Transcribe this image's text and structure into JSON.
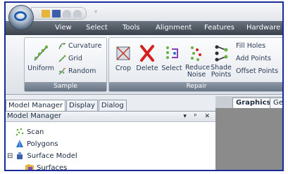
{
  "quick_access": {
    "icons": [
      "open-icon",
      "save-icon",
      "undo-icon",
      "redo-icon"
    ],
    "menu_glyph": "▿"
  },
  "menu_tabs": [
    "View",
    "Select",
    "Tools",
    "Alignment",
    "Features",
    "Hardware"
  ],
  "ribbon": {
    "sample_group": {
      "label": "Sample",
      "uniform": "Uniform",
      "curvature": "Curvature",
      "grid": "Grid",
      "random": "Random"
    },
    "repair_group": {
      "label": "Repair",
      "crop": "Crop",
      "delete": "Delete",
      "select": "Select",
      "reduce_noise_line1": "Reduce",
      "reduce_noise_line2": "Noise",
      "shade_points_line1": "Shade",
      "shade_points_line2": "Points",
      "fill_holes": "Fill Holes",
      "add_points": "Add Points",
      "offset_points": "Offset Points"
    }
  },
  "panel_tabs": [
    "Model Manager",
    "Display",
    "Dialog"
  ],
  "model_manager": {
    "title": "Model Manager",
    "pin_glyph": "▾ ᵖ ✕",
    "tree": [
      {
        "label": "Scan",
        "icon": "scan-icon"
      },
      {
        "label": "Polygons",
        "icon": "polygons-icon"
      },
      {
        "label": "Surface Model",
        "icon": "surface-model-icon",
        "expander": "⊟"
      },
      {
        "label": "Surfaces",
        "icon": "surfaces-icon"
      }
    ]
  },
  "graphics_tabs": [
    "Graphics",
    "Get"
  ],
  "colors": {
    "frame_border": "#1a2a9c",
    "tab_bar": "#3a414b",
    "graphics_bg": "#8b8b8b"
  }
}
